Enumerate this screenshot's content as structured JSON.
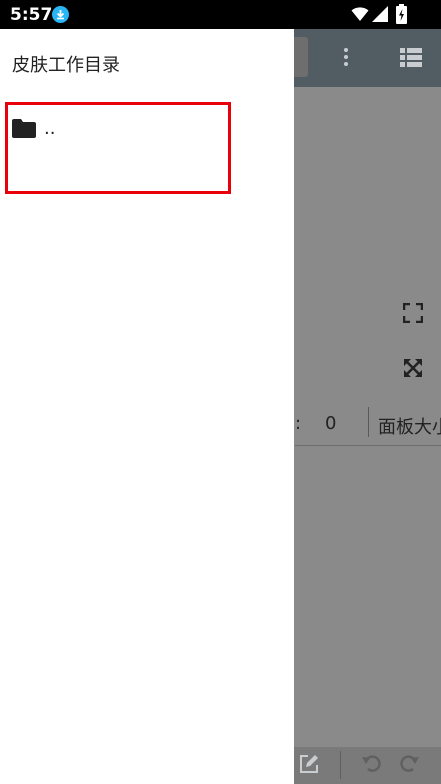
{
  "status_bar": {
    "time": "5:57"
  },
  "drawer": {
    "title": "皮肤工作目录",
    "items": [
      {
        "label": "..",
        "icon": "folder-icon"
      }
    ]
  },
  "background_app": {
    "info_colon": ":",
    "info_value": "0",
    "panel_label": "面板大小"
  },
  "colors": {
    "toolbar": "#525c63",
    "highlight": "#e8000b",
    "download_badge": "#29b6f6"
  }
}
